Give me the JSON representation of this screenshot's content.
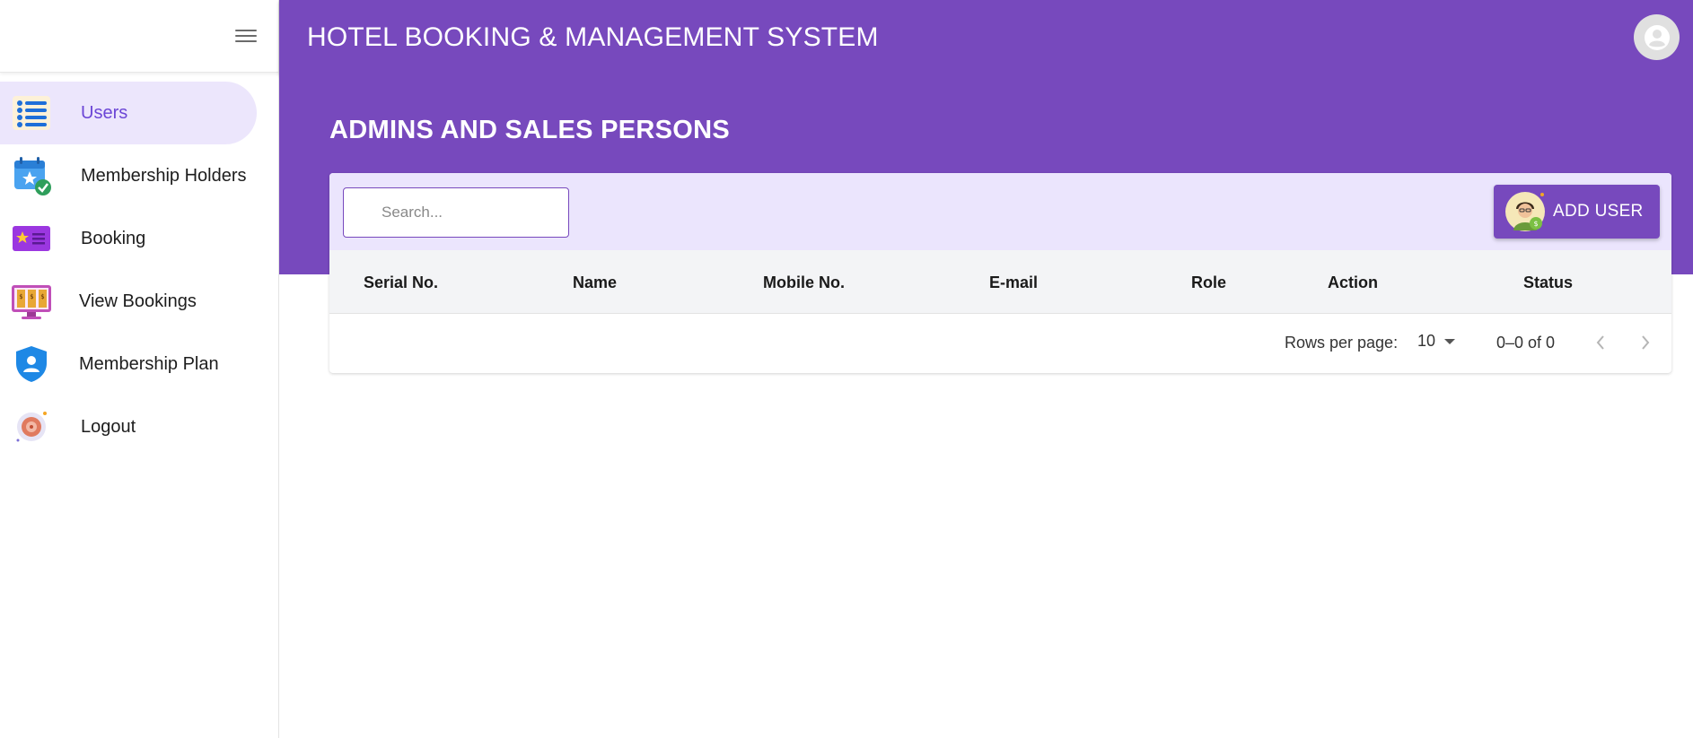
{
  "app": {
    "title": "HOTEL BOOKING & MANAGEMENT SYSTEM"
  },
  "sidebar": {
    "items": [
      {
        "label": "Users",
        "icon": "users-list-icon",
        "active": true
      },
      {
        "label": "Membership Holders",
        "icon": "calendar-star-check-icon"
      },
      {
        "label": "Booking",
        "icon": "ticket-star-icon"
      },
      {
        "label": "View Bookings",
        "icon": "monitor-bookings-icon"
      },
      {
        "label": "Membership Plan",
        "icon": "shield-user-icon"
      },
      {
        "label": "Logout",
        "icon": "logout-icon"
      }
    ]
  },
  "page": {
    "heading": "ADMINS AND SALES PERSONS"
  },
  "search": {
    "placeholder": "Search...",
    "value": ""
  },
  "toolbar": {
    "add_user_label": "ADD USER"
  },
  "table": {
    "columns": [
      "Serial No.",
      "Name",
      "Mobile No.",
      "E-mail",
      "Role",
      "Action",
      "Status"
    ],
    "rows": []
  },
  "pagination": {
    "rows_per_page_label": "Rows per page:",
    "rows_per_page": "10",
    "range": "0–0 of 0"
  },
  "colors": {
    "primary": "#7749bd",
    "active_nav_bg": "#ece6fc",
    "toolbar_bg": "#ebe5fd",
    "table_header_bg": "#f3f4f6"
  }
}
